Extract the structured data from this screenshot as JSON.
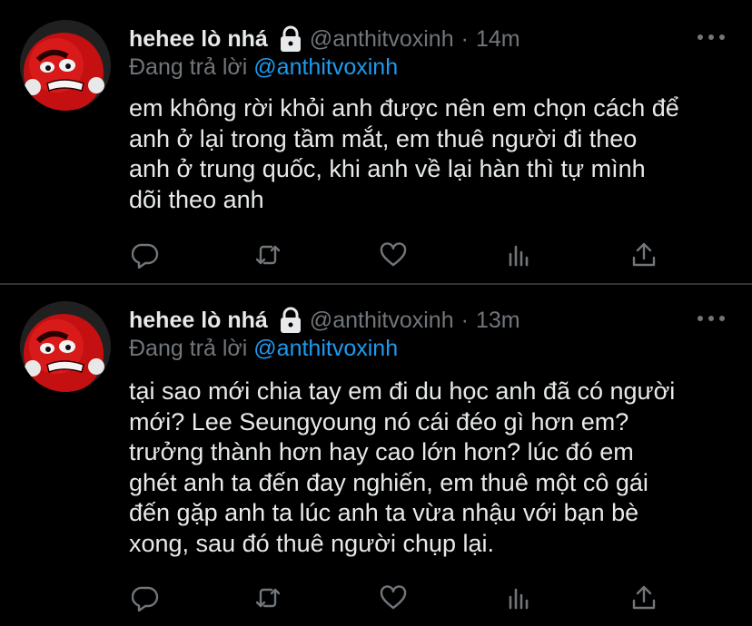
{
  "tweets": [
    {
      "name": "hehee lò nhá",
      "handle": "@anthitvoxinh",
      "separator": "·",
      "time": "14m",
      "reply_prefix": "Đang trả lời",
      "reply_to": "@anthitvoxinh",
      "lines": [
        "em không rời khỏi anh được nên em chọn cách để",
        "anh ở lại trong tầm mắt, em thuê người đi theo",
        "anh ở trung quốc, khi anh về lại hàn thì tự mình",
        "dõi theo anh"
      ]
    },
    {
      "name": "hehee lò nhá",
      "handle": "@anthitvoxinh",
      "separator": "·",
      "time": "13m",
      "reply_prefix": "Đang trả lời",
      "reply_to": "@anthitvoxinh",
      "lines": [
        "tại sao mới chia tay em đi du học anh đã có người",
        "mới? Lee Seungyoung nó cái đéo gì hơn em?",
        "trưởng thành hơn hay cao lớn hơn? lúc đó em",
        "ghét anh ta đến đay nghiến, em thuê một cô gái",
        "đến gặp anh ta lúc anh ta vừa nhậu với bạn bè",
        "xong, sau đó thuê người chụp lại."
      ]
    }
  ],
  "icons": {
    "lock": "lock-icon",
    "more": "more-icon",
    "reply": "reply-icon",
    "retweet": "retweet-icon",
    "like": "heart-icon",
    "analytics": "analytics-icon",
    "share": "share-icon"
  },
  "colors": {
    "background": "#000000",
    "text": "#e7e9ea",
    "muted": "#71767b",
    "link": "#1d9bf0",
    "divider": "#2f3336"
  }
}
